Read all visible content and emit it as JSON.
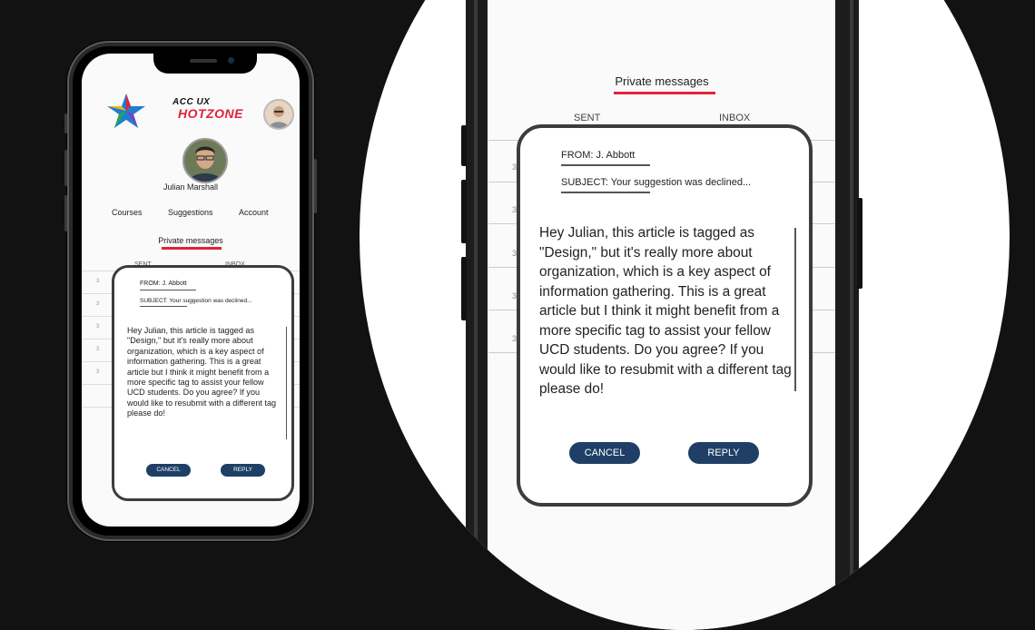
{
  "brand": {
    "line1": "ACC UX",
    "line2": "HOTZONE"
  },
  "profile": {
    "name": "Julian Marshall"
  },
  "nav": {
    "items": [
      "Courses",
      "Suggestions",
      "Account"
    ]
  },
  "section": {
    "title": "Private messages"
  },
  "tabs": {
    "sent": "SENT",
    "inbox": "INBOX"
  },
  "rows": {
    "marker": "3"
  },
  "message": {
    "from": "FROM: J. Abbott",
    "subject": "SUBJECT: Your suggestion was declined...",
    "body": "Hey Julian, this article is tagged as \"Design,\" but it's really more about organization, which is a key aspect of information gathering. This is a great article but I think it might benefit from a more specific tag to assist your fellow UCD students. Do you agree? If you would like to resubmit with a different tag please do!"
  },
  "actions": {
    "cancel": "CANCEL",
    "reply": "REPLY"
  },
  "colors": {
    "accent_red": "#e0233a",
    "button_navy": "#1f3f66",
    "dialog_border": "#3c3c3c",
    "background": "#121212"
  },
  "icons": {
    "logo": "star-logo-icon",
    "avatar": "user-avatar"
  }
}
